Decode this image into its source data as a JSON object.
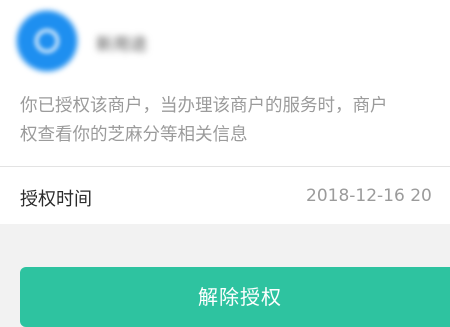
{
  "merchant": {
    "logo_icon": "merchant-logo-icon",
    "name": "新用途"
  },
  "notice_text": "你已授权该商户，当办理该商户的服务时，商户\n权查看你的芝麻分等相关信息",
  "auth_time": {
    "label": "授权时间",
    "value": "2018-12-16 20"
  },
  "actions": {
    "revoke_label": "解除授权"
  },
  "colors": {
    "accent": "#2ec3a0",
    "logo": "#1e8ff0"
  }
}
